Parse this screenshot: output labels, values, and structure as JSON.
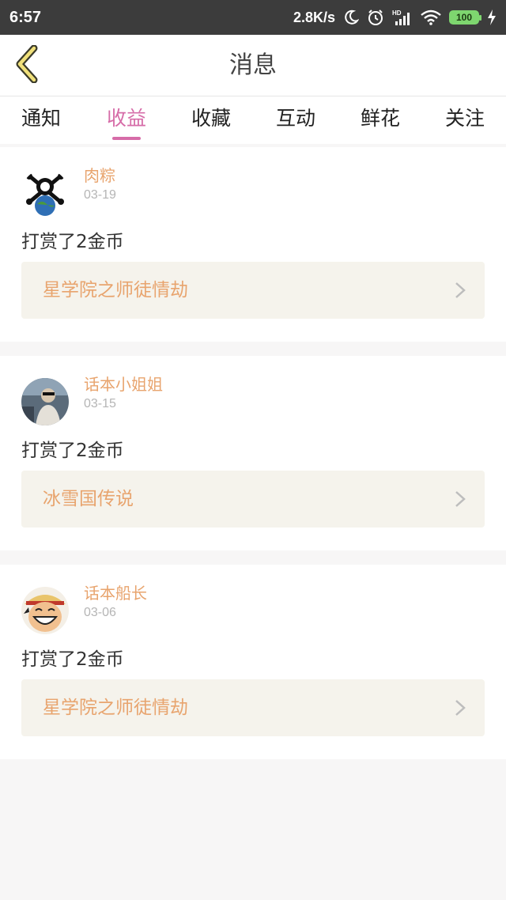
{
  "status_bar": {
    "time": "6:57",
    "net_speed": "2.8K/s",
    "battery": "100",
    "icons": [
      "moon-icon",
      "alarm-icon",
      "hd-signal-icon",
      "wifi-icon",
      "battery-icon",
      "charging-icon"
    ]
  },
  "header": {
    "title": "消息",
    "back_icon": "chevron-left-icon"
  },
  "tabs": [
    {
      "label": "通知"
    },
    {
      "label": "收益",
      "active": true
    },
    {
      "label": "收藏"
    },
    {
      "label": "互动"
    },
    {
      "label": "鲜花"
    },
    {
      "label": "关注"
    }
  ],
  "messages": [
    {
      "user": "肉粽",
      "date": "03-19",
      "text": "打赏了2金币",
      "book": "星学院之师徒情劫",
      "avatar": "skull-earth-avatar"
    },
    {
      "user": "话本小姐姐",
      "date": "03-15",
      "text": "打赏了2金币",
      "book": "冰雪国传说",
      "avatar": "photo-avatar"
    },
    {
      "user": "话本船长",
      "date": "03-06",
      "text": "打赏了2金币",
      "book": "星学院之师徒情劫",
      "avatar": "cartoon-avatar"
    }
  ],
  "colors": {
    "accent": "#d66ca8",
    "name": "#e8a46e",
    "book_bg": "#f5f3ec",
    "page_bg": "#f7f6f6"
  }
}
